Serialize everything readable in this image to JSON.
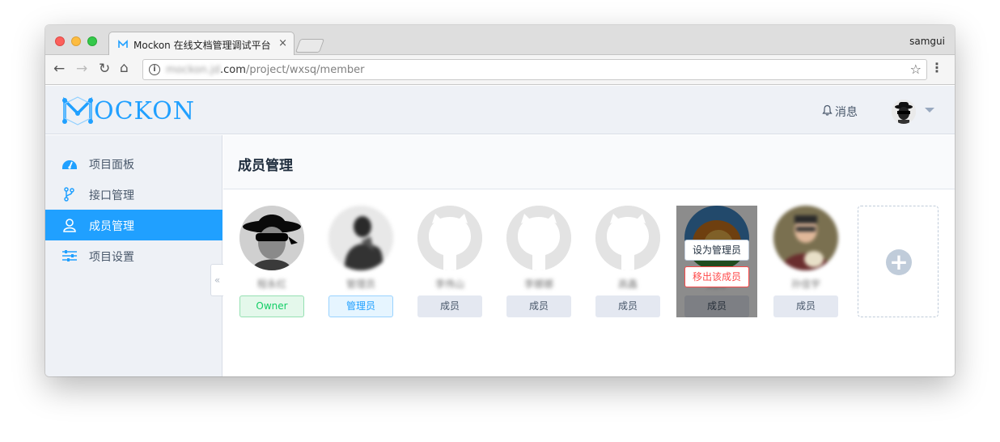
{
  "browser": {
    "tab_title": "Mockon 在线文档管理调试平台",
    "tab_close": "×",
    "profile_name": "samgui",
    "url_host_blurred": "mockon.jd",
    "url_domain": ".com",
    "url_path": "/project/wxsq/member"
  },
  "header": {
    "logo_text": "OCKON",
    "messages_label": "消息"
  },
  "sidebar": {
    "items": [
      {
        "label": "项目面板",
        "icon": "dashboard-icon"
      },
      {
        "label": "接口管理",
        "icon": "branch-icon"
      },
      {
        "label": "成员管理",
        "icon": "user-icon",
        "active": true
      },
      {
        "label": "项目设置",
        "icon": "sliders-icon"
      }
    ],
    "collapse_glyph": "«"
  },
  "page": {
    "title": "成员管理"
  },
  "members": [
    {
      "name": "程永红",
      "role": "Owner",
      "role_type": "owner",
      "avatar": "bandit"
    },
    {
      "name": "管理员",
      "role": "管理员",
      "role_type": "admin",
      "avatar": "photo-bw"
    },
    {
      "name": "李伟山",
      "role": "成员",
      "role_type": "member",
      "avatar": "github"
    },
    {
      "name": "李娜娜",
      "role": "成员",
      "role_type": "member",
      "avatar": "github"
    },
    {
      "name": "高鑫",
      "role": "成员",
      "role_type": "member",
      "avatar": "github"
    },
    {
      "name": "刘洋",
      "role": "成员",
      "role_type": "member",
      "avatar": "lion"
    },
    {
      "name": "孙佳宇",
      "role": "成员",
      "role_type": "member",
      "avatar": "photo-color"
    }
  ],
  "hover_menu": {
    "set_admin": "设为管理员",
    "remove": "移出该成员"
  },
  "add_member": {
    "glyph": "+"
  },
  "colors": {
    "accent": "#20a0ff",
    "owner": "#13ce66",
    "danger": "#ff4949"
  }
}
